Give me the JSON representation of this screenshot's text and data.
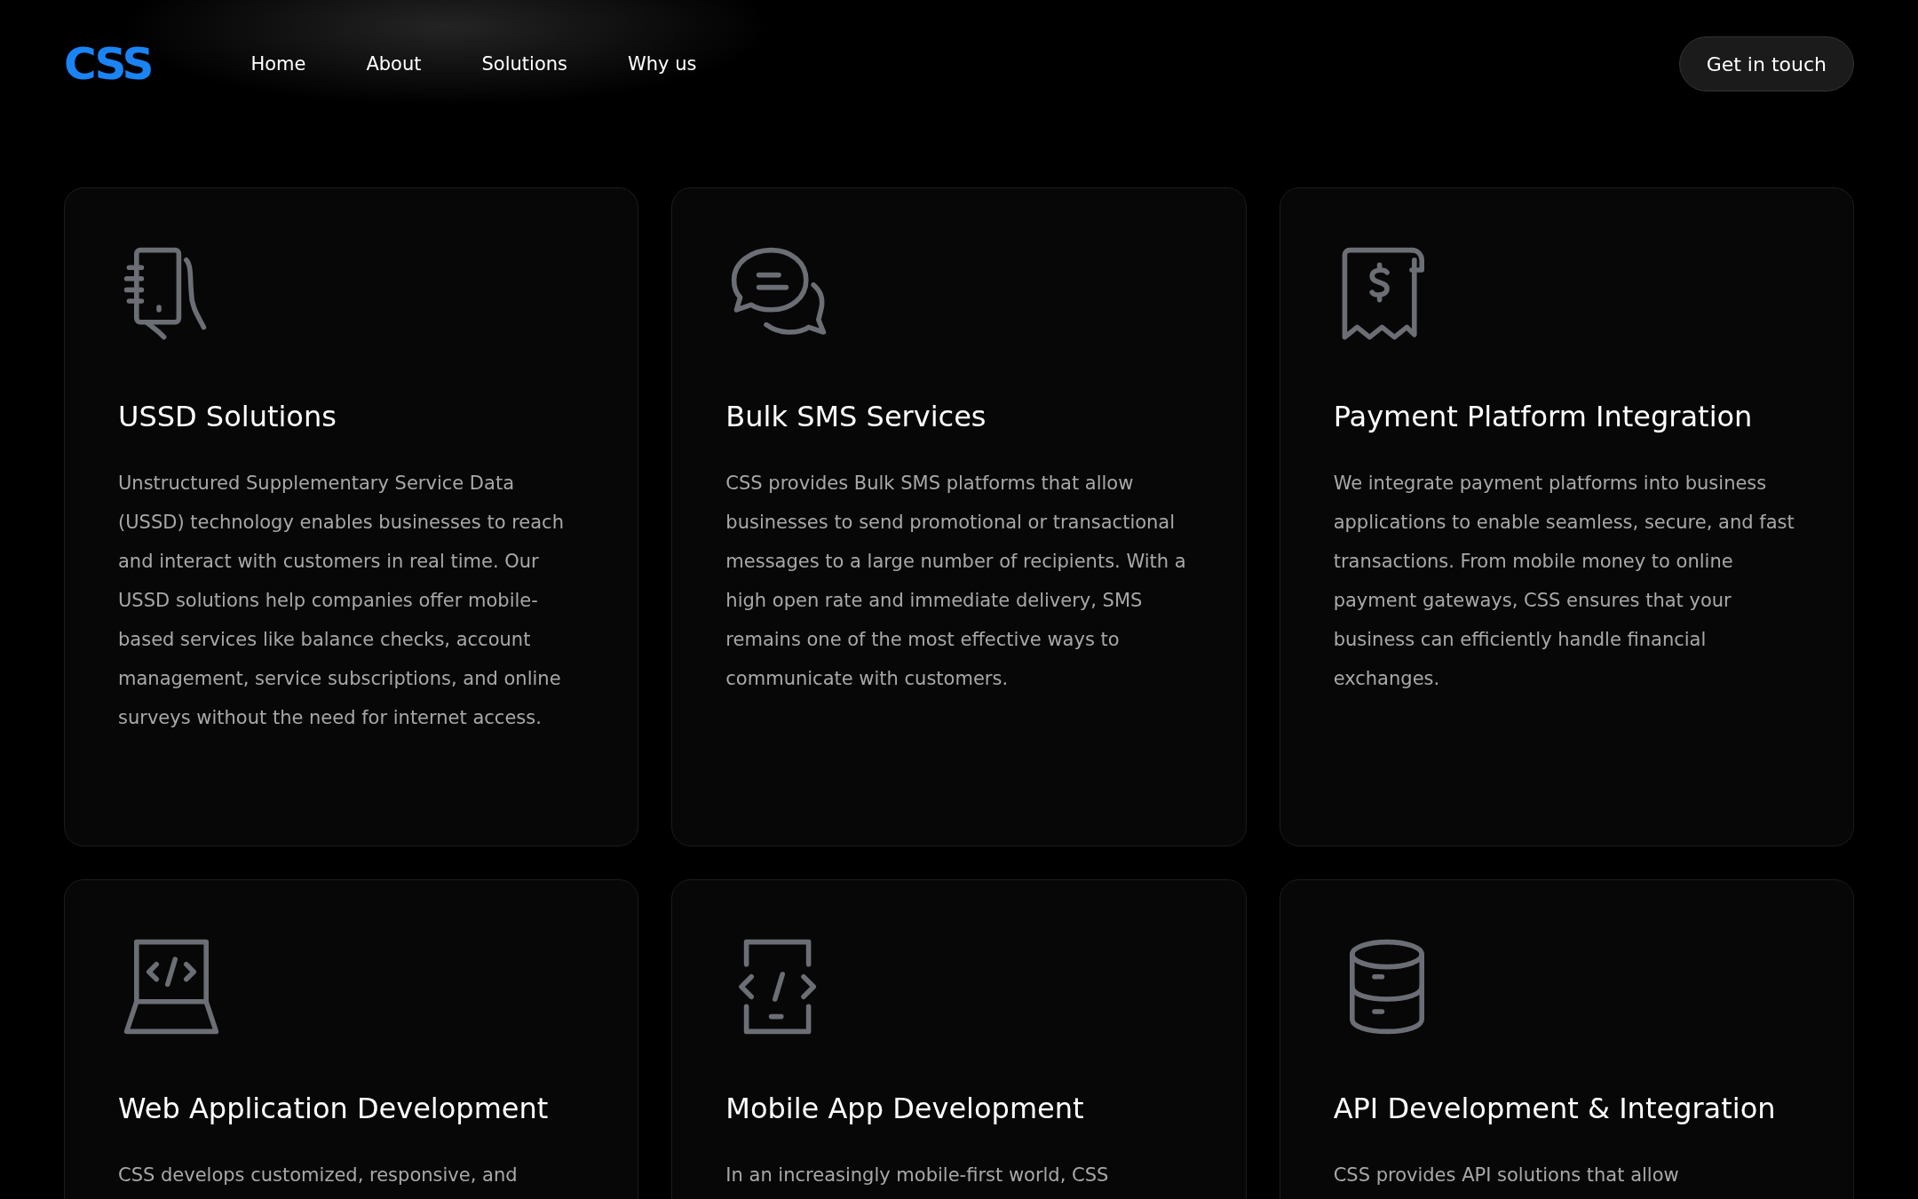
{
  "header": {
    "logo": "CSS",
    "nav": [
      {
        "label": "Home"
      },
      {
        "label": "About"
      },
      {
        "label": "Solutions"
      },
      {
        "label": "Why us"
      }
    ],
    "cta": "Get in touch"
  },
  "cards": [
    {
      "kind": "phone",
      "title": "USSD Solutions",
      "body": "Unstructured Supplementary Service Data (USSD) technology enables businesses to reach and interact with customers in real time. Our USSD solutions help companies offer mobile-based services like balance checks, account management, service subscriptions, and online surveys without the need for internet access."
    },
    {
      "kind": "chat",
      "title": "Bulk SMS Services",
      "body": "CSS provides Bulk SMS platforms that allow businesses to send promotional or transactional messages to a large number of recipients. With a high open rate and immediate delivery, SMS remains one of the most effective ways to communicate with customers."
    },
    {
      "kind": "receipt",
      "title": "Payment Platform Integration",
      "body": "We integrate payment platforms into business applications to enable seamless, secure, and fast transactions. From mobile money to online payment gateways, CSS ensures that your business can efficiently handle financial exchanges."
    },
    {
      "kind": "laptop",
      "title": "Web Application Development",
      "body": "CSS develops customized, responsive, and"
    },
    {
      "kind": "mobile-code",
      "title": "Mobile App Development",
      "body": "In an increasingly mobile-first world, CSS"
    },
    {
      "kind": "database",
      "title": "API Development & Integration",
      "body": "CSS provides API solutions that allow"
    }
  ]
}
